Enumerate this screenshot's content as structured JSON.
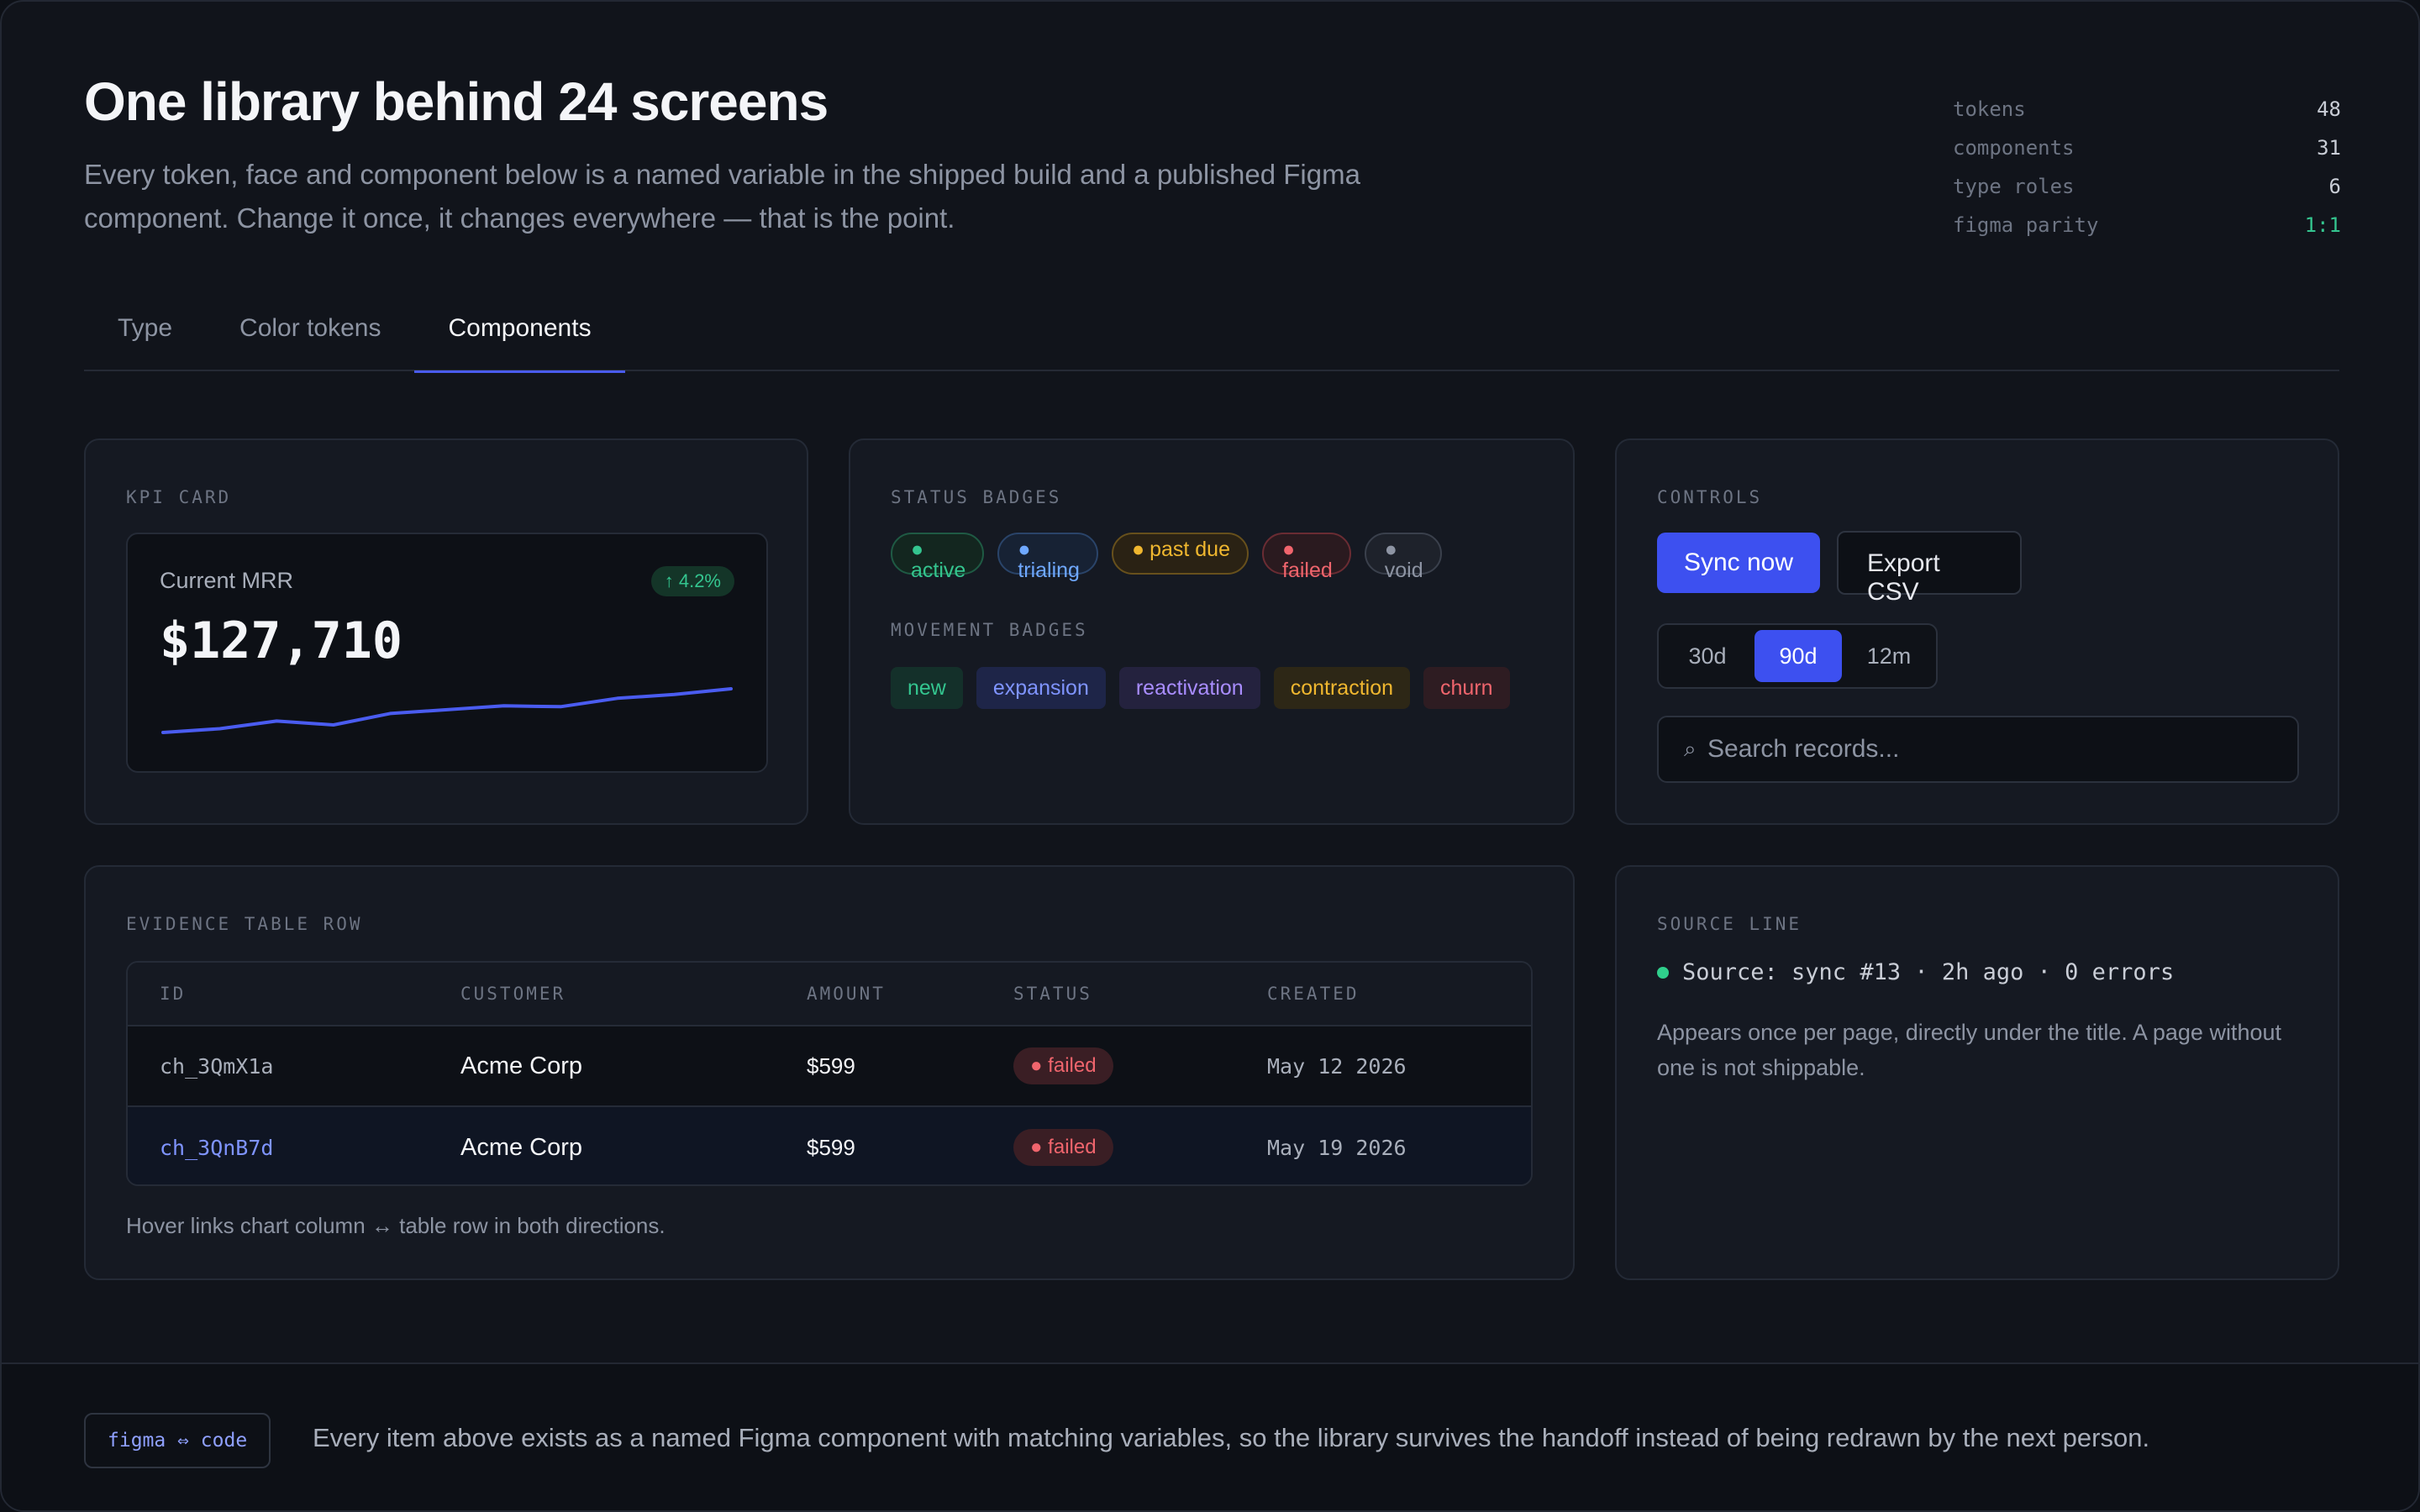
{
  "header": {
    "title": "One library behind 24 screens",
    "subtitle": "Every token, face and component below is a named variable in the shipped build and a published Figma component. Change it once, it changes everywhere — that is the point."
  },
  "stats": [
    {
      "label": "tokens",
      "value": "48"
    },
    {
      "label": "components",
      "value": "31"
    },
    {
      "label": "type roles",
      "value": "6"
    },
    {
      "label": "figma parity",
      "value": "1:1"
    }
  ],
  "tabs": [
    {
      "label": "Type",
      "active": false
    },
    {
      "label": "Color tokens",
      "active": false
    },
    {
      "label": "Components",
      "active": true
    }
  ],
  "kpi_card": {
    "section_label": "KPI CARD",
    "metric": "Current MRR",
    "delta": "↑ 4.2%",
    "value": "$127,710",
    "sparkline": [
      118,
      119,
      121,
      120,
      123,
      124,
      125,
      124.8,
      127,
      128,
      129.5
    ]
  },
  "status_badges": {
    "section_label": "STATUS BADGES",
    "items": [
      {
        "label": "active",
        "color": "#34c58f"
      },
      {
        "label": "trialing",
        "color": "#6fa8ff"
      },
      {
        "label": "past due",
        "color": "#f0b72f"
      },
      {
        "label": "failed",
        "color": "#f0656d"
      },
      {
        "label": "void",
        "color": "#8d94a3"
      }
    ]
  },
  "movement_badges": {
    "section_label": "MOVEMENT BADGES",
    "items": [
      {
        "label": "new",
        "color": "#34c58f"
      },
      {
        "label": "expansion",
        "color": "#7f94ff"
      },
      {
        "label": "reactivation",
        "color": "#a98dff"
      },
      {
        "label": "contraction",
        "color": "#f0b72f"
      },
      {
        "label": "churn",
        "color": "#f0656d"
      }
    ]
  },
  "controls": {
    "section_label": "CONTROLS",
    "primary_button": "Sync now",
    "secondary_button": "Export CSV",
    "range_options": [
      "30d",
      "90d",
      "12m"
    ],
    "range_selected": "90d",
    "search_placeholder": "Search records..."
  },
  "evidence_table": {
    "section_label": "EVIDENCE TABLE ROW",
    "columns": [
      "ID",
      "CUSTOMER",
      "AMOUNT",
      "STATUS",
      "CREATED"
    ],
    "rows": [
      {
        "id": "ch_3QmX1a",
        "customer": "Acme Corp",
        "amount": "$599",
        "status": "failed",
        "created": "May 12 2026"
      },
      {
        "id": "ch_3QnB7d",
        "customer": "Acme Corp",
        "amount": "$599",
        "status": "failed",
        "created": "May 19 2026"
      }
    ],
    "note": "Hover links chart column ↔ table row in both directions."
  },
  "source_line": {
    "section_label": "SOURCE LINE",
    "text": "Source: sync #13 · 2h ago · 0 errors",
    "description": "Appears once per page, directly under the title. A page without one is not shippable."
  },
  "footer": {
    "tag": "figma ⇔ code",
    "text": "Every item above exists as a named Figma component with matching variables, so the library survives the handoff instead of being redrawn by the next person."
  },
  "colors": {
    "accent": "#3d50f0",
    "success": "#34c58f",
    "danger": "#f0656d"
  }
}
